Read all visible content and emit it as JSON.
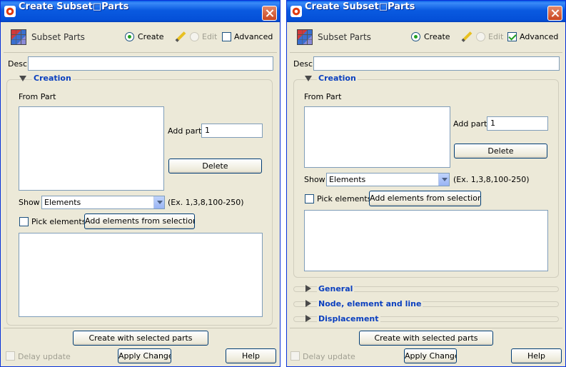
{
  "dialog": {
    "title": "Create Subset□Parts",
    "header_title": "Subset Parts",
    "mode_create": "Create",
    "mode_edit": "Edit",
    "advanced_label": "Advanced",
    "desc_label": "Desc.",
    "creation_title": "Creation",
    "from_part_label": "From Part",
    "add_part_label": "Add part",
    "add_part_value": "1",
    "delete_label": "Delete",
    "show_label": "Show",
    "show_value": "Elements",
    "example_hint": "(Ex. 1,3,8,100-250)",
    "pick_elements_label": "Pick elements",
    "add_from_tool_label": "Add elements from selection tool",
    "create_with_selected_label": "Create with selected parts",
    "delay_update_label": "Delay update",
    "apply_changes_label": "Apply Changes",
    "help_label": "Help"
  },
  "left_window": {
    "advanced_checked": false
  },
  "right_window": {
    "advanced_checked": true,
    "sections": [
      {
        "title": "General"
      },
      {
        "title": "Node, element and line"
      },
      {
        "title": "Displacement"
      }
    ]
  },
  "colors": {
    "titlebar": "#0a5ae0",
    "dialog_bg": "#ece9d8",
    "section_title": "#0a3fbf"
  }
}
